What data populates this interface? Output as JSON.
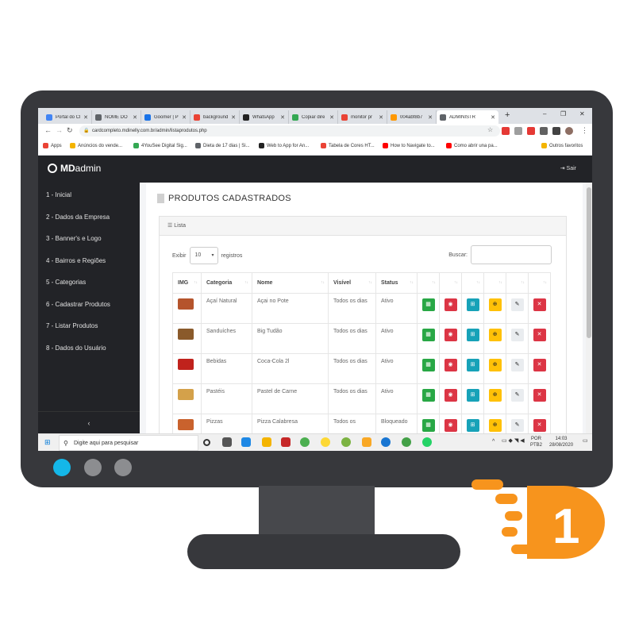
{
  "browser": {
    "tabs": [
      {
        "label": "Portal do Cl",
        "color": "#4285f4"
      },
      {
        "label": "NOME DO",
        "color": "#5f6368"
      },
      {
        "label": "Goomer | P",
        "color": "#1a73e8"
      },
      {
        "label": "background",
        "color": "#ea4335"
      },
      {
        "label": "WhatsApp",
        "color": "#222222"
      },
      {
        "label": "Copiar dire",
        "color": "#34a853"
      },
      {
        "label": "monitor pr",
        "color": "#ea4335"
      },
      {
        "label": "004abf8b7",
        "color": "#ff9800"
      },
      {
        "label": "ADMINISTR",
        "color": "#5f6368"
      }
    ],
    "new_tab": "+",
    "window_controls": [
      "–",
      "❐",
      "✕"
    ],
    "url": "cardcompleto.mdinelly.com.br/admin/listaprodutos.php",
    "bookmarks": [
      {
        "label": "Apps",
        "color": "#ea4335"
      },
      {
        "label": "Anúncios do vende...",
        "color": "#f4b400"
      },
      {
        "label": "4YouSee Digital Sig...",
        "color": "#34a853"
      },
      {
        "label": "Dieta de 17 dias | Si...",
        "color": "#5f6368"
      },
      {
        "label": "Web to App for An...",
        "color": "#222222"
      },
      {
        "label": "Tabela de Cores HT...",
        "color": "#ea4335"
      },
      {
        "label": "How to Navigate to...",
        "color": "#ff0000"
      },
      {
        "label": "Como abrir una pa...",
        "color": "#ff0000"
      },
      {
        "label": "Outros favoritos",
        "color": "#f4b400"
      }
    ]
  },
  "app": {
    "brand_strong": "MD",
    "brand_rest": "admin",
    "logout": "Sair",
    "menu": [
      "1 - Inicial",
      "2 - Dados da Empresa",
      "3 - Banner's e Logo",
      "4 - Bairros e Regiões",
      "5 - Categorias",
      "6 - Cadastrar Produtos",
      "7 - Listar Produtos",
      "8 - Dados do Usuário"
    ],
    "collapse": "‹",
    "page_title": "PRODUTOS CADASTRADOS",
    "list_label": "Lista",
    "show_label": "Exibir",
    "show_value": "10",
    "show_suffix": "registros",
    "search_label": "Buscar:",
    "columns": [
      "IMG",
      "Categoria",
      "Nome",
      "Visível",
      "Status"
    ],
    "rows": [
      {
        "thumb": "#b5542c",
        "categoria": "Açaí Natural",
        "nome": "Açai no Pote",
        "visivel": "Todos os dias",
        "status": "Ativo"
      },
      {
        "thumb": "#8a5a2b",
        "categoria": "Sanduíches",
        "nome": "Big Tudão",
        "visivel": "Todos os dias",
        "status": "Ativo"
      },
      {
        "thumb": "#c0221c",
        "categoria": "Bebidas",
        "nome": "Coca-Cola 2l",
        "visivel": "Todos os dias",
        "status": "Ativo"
      },
      {
        "thumb": "#d4a14a",
        "categoria": "Pastéis",
        "nome": "Pastel de Carne",
        "visivel": "Todos os dias",
        "status": "Ativo"
      },
      {
        "thumb": "#c9622d",
        "categoria": "Pizzas",
        "nome": "Pizza Calabresa",
        "visivel": "Todos os",
        "status": "Bloqueado"
      }
    ],
    "action_colors": {
      "calendar": "#28a745",
      "view": "#dc3545",
      "add": "#17a2b8",
      "plus": "#ffc107",
      "edit": "#e9ecef",
      "delete": "#dc3545"
    }
  },
  "taskbar": {
    "search_placeholder": "Digite aqui para pesquisar",
    "lang_1": "POR",
    "lang_2": "PTB2",
    "time": "14:03",
    "date": "28/08/2020"
  },
  "logo": {
    "numeral": "1",
    "color": "#f7941d"
  }
}
